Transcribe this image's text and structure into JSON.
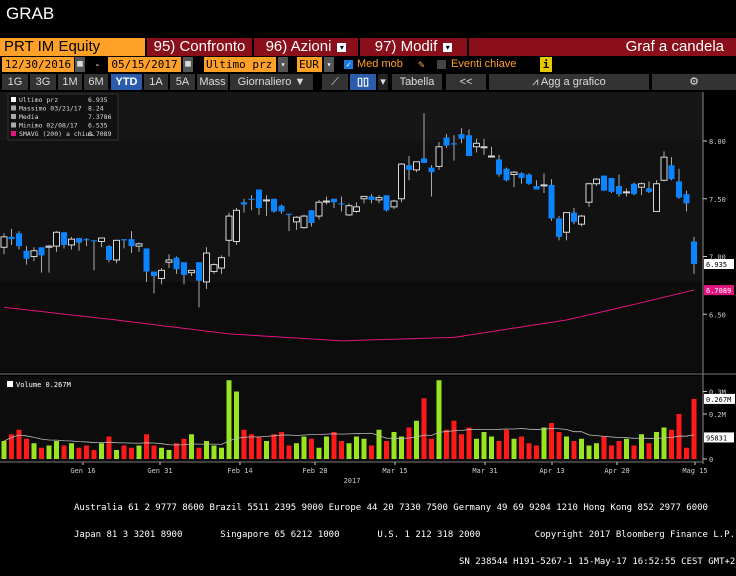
{
  "title": "GRAB",
  "toolbar1": {
    "security": "PRT IM Equity",
    "compare": "95) Confronto",
    "actions": "96) Azioni",
    "edit": "97) Modif",
    "chart_type": "Graf a candela"
  },
  "toolbar2": {
    "start_date": "12/30/2016",
    "dash": "-",
    "end_date": "05/15/2017",
    "field": "Ultimo prz",
    "currency": "EUR",
    "moving_avg_label": "Med mob",
    "moving_avg_checked": true,
    "events_label": "Eventi chiave",
    "events_checked": false,
    "info": "i"
  },
  "toolbar3": {
    "periods": [
      "1G",
      "3G",
      "1M",
      "6M",
      "YTD",
      "1A",
      "5A",
      "Mass"
    ],
    "selected_period": "YTD",
    "frequency": "Giornaliero ▼",
    "table": "Tabella",
    "collapse": "<<",
    "add_to_chart": "Agg a grafico"
  },
  "legend": [
    {
      "label": "Ultimo prz",
      "value": "6.935"
    },
    {
      "label": "Massimo 03/21/17",
      "value": "8.24"
    },
    {
      "label": "Media",
      "value": "7.3786"
    },
    {
      "label": "Minimo 02/08/17",
      "value": "6.535"
    },
    {
      "label": "SMAVG (200) a chius",
      "value": "6.7089"
    }
  ],
  "volume_legend": "Volume 0.267M",
  "colors": {
    "up_candle": "#ffffff",
    "down_candle": "#0a84ff",
    "sma": "#e0157f",
    "vol_up": "#99e620",
    "vol_down": "#ff1a1a",
    "last_price_tag": "#ffffff",
    "sma_tag": "#e0157f"
  },
  "chart_data": {
    "type": "candlestick",
    "price_axis": {
      "ticks": [
        "8.00",
        "7.50",
        "7.00",
        "6.50"
      ],
      "ylim": [
        6.2,
        8.4
      ]
    },
    "last_price_label": "6.935",
    "sma_label": "6.7089",
    "ohlc": [
      [
        7.08,
        7.2,
        7.02,
        7.17
      ],
      [
        7.17,
        7.24,
        7.1,
        7.15
      ],
      [
        7.2,
        7.22,
        7.06,
        7.09
      ],
      [
        7.05,
        7.09,
        6.93,
        6.98
      ],
      [
        7.0,
        7.08,
        6.96,
        7.05
      ],
      [
        7.08,
        7.08,
        6.86,
        7.01
      ],
      [
        7.08,
        7.1,
        6.86,
        7.09
      ],
      [
        7.09,
        7.22,
        7.04,
        7.21
      ],
      [
        7.21,
        7.21,
        7.07,
        7.1
      ],
      [
        7.1,
        7.17,
        7.06,
        7.15
      ],
      [
        7.16,
        7.16,
        7.05,
        7.12
      ],
      [
        7.15,
        7.16,
        7.09,
        7.14
      ],
      [
        7.14,
        7.14,
        6.88,
        7.13
      ],
      [
        7.13,
        7.16,
        7.08,
        7.16
      ],
      [
        7.09,
        7.1,
        6.95,
        6.97
      ],
      [
        6.97,
        7.14,
        6.94,
        7.14
      ],
      [
        7.15,
        7.15,
        7.07,
        7.14
      ],
      [
        7.15,
        7.22,
        7.03,
        7.09
      ],
      [
        7.09,
        7.12,
        7.04,
        7.11
      ],
      [
        7.07,
        7.07,
        6.78,
        6.87
      ],
      [
        6.87,
        6.87,
        6.68,
        6.83
      ],
      [
        6.81,
        6.9,
        6.76,
        6.88
      ],
      [
        6.95,
        7.02,
        6.9,
        6.97
      ],
      [
        6.99,
        7.0,
        6.85,
        6.89
      ],
      [
        6.95,
        6.95,
        6.76,
        6.84
      ],
      [
        6.86,
        6.88,
        6.83,
        6.88
      ],
      [
        6.95,
        6.95,
        6.56,
        6.79
      ],
      [
        6.78,
        7.08,
        6.72,
        7.03
      ],
      [
        6.87,
        6.94,
        6.85,
        6.93
      ],
      [
        6.9,
        7.01,
        6.85,
        6.99
      ],
      [
        7.14,
        7.38,
        7.0,
        7.35
      ],
      [
        7.13,
        7.42,
        7.1,
        7.4
      ],
      [
        7.47,
        7.5,
        7.38,
        7.45
      ],
      [
        7.5,
        7.53,
        7.4,
        7.49
      ],
      [
        7.58,
        7.58,
        7.36,
        7.42
      ],
      [
        7.49,
        7.53,
        7.35,
        7.49
      ],
      [
        7.5,
        7.5,
        7.38,
        7.39
      ],
      [
        7.44,
        7.45,
        7.37,
        7.39
      ],
      [
        7.37,
        7.37,
        7.22,
        7.36
      ],
      [
        7.3,
        7.35,
        7.23,
        7.34
      ],
      [
        7.25,
        7.36,
        7.24,
        7.35
      ],
      [
        7.4,
        7.4,
        7.26,
        7.29
      ],
      [
        7.35,
        7.49,
        7.32,
        7.47
      ],
      [
        7.48,
        7.52,
        7.45,
        7.48
      ],
      [
        7.5,
        7.5,
        7.42,
        7.47
      ],
      [
        7.46,
        7.52,
        7.39,
        7.45
      ],
      [
        7.36,
        7.46,
        7.35,
        7.44
      ],
      [
        7.39,
        7.47,
        7.38,
        7.43
      ],
      [
        7.5,
        7.52,
        7.46,
        7.52
      ],
      [
        7.52,
        7.54,
        7.46,
        7.49
      ],
      [
        7.49,
        7.53,
        7.46,
        7.51
      ],
      [
        7.53,
        7.53,
        7.39,
        7.4
      ],
      [
        7.43,
        7.49,
        7.41,
        7.48
      ],
      [
        7.5,
        7.81,
        7.47,
        7.8
      ],
      [
        7.79,
        7.87,
        7.66,
        7.75
      ],
      [
        7.75,
        7.82,
        7.73,
        7.82
      ],
      [
        7.85,
        8.24,
        7.81,
        7.81
      ],
      [
        7.77,
        7.79,
        7.52,
        7.73
      ],
      [
        7.78,
        7.99,
        7.75,
        7.95
      ],
      [
        8.03,
        8.06,
        7.94,
        7.96
      ],
      [
        7.98,
        8.05,
        7.83,
        7.97
      ],
      [
        8.06,
        8.11,
        7.98,
        8.02
      ],
      [
        8.05,
        8.1,
        7.87,
        7.87
      ],
      [
        7.95,
        8.02,
        7.9,
        7.98
      ],
      [
        7.95,
        8.02,
        7.88,
        7.95
      ],
      [
        7.87,
        7.95,
        7.86,
        7.87
      ],
      [
        7.84,
        7.88,
        7.69,
        7.71
      ],
      [
        7.76,
        7.77,
        7.65,
        7.66
      ],
      [
        7.71,
        7.74,
        7.6,
        7.73
      ],
      [
        7.72,
        7.73,
        7.63,
        7.68
      ],
      [
        7.71,
        7.72,
        7.62,
        7.63
      ],
      [
        7.61,
        7.66,
        7.59,
        7.58
      ],
      [
        7.62,
        7.72,
        7.55,
        7.62
      ],
      [
        7.62,
        7.67,
        7.31,
        7.33
      ],
      [
        7.33,
        7.35,
        7.14,
        7.17
      ],
      [
        7.21,
        7.38,
        7.14,
        7.38
      ],
      [
        7.38,
        7.42,
        7.28,
        7.3
      ],
      [
        7.28,
        7.36,
        7.26,
        7.35
      ],
      [
        7.47,
        7.64,
        7.43,
        7.63
      ],
      [
        7.63,
        7.68,
        7.61,
        7.67
      ],
      [
        7.7,
        7.7,
        7.57,
        7.57
      ],
      [
        7.68,
        7.68,
        7.55,
        7.56
      ],
      [
        7.61,
        7.71,
        7.52,
        7.54
      ],
      [
        7.56,
        7.59,
        7.52,
        7.56
      ],
      [
        7.63,
        7.64,
        7.53,
        7.54
      ],
      [
        7.6,
        7.64,
        7.53,
        7.63
      ],
      [
        7.59,
        7.65,
        7.55,
        7.56
      ],
      [
        7.39,
        7.66,
        7.39,
        7.63
      ],
      [
        7.66,
        7.91,
        7.65,
        7.86
      ],
      [
        7.79,
        7.86,
        7.66,
        7.67
      ],
      [
        7.65,
        7.76,
        7.5,
        7.51
      ],
      [
        7.54,
        7.57,
        7.39,
        7.46
      ],
      [
        7.13,
        7.17,
        6.85,
        6.935
      ]
    ],
    "sma200": [
      [
        0,
        6.56
      ],
      [
        15,
        6.45
      ],
      [
        30,
        6.33
      ],
      [
        45,
        6.27
      ],
      [
        60,
        6.3
      ],
      [
        75,
        6.45
      ],
      [
        85,
        6.6
      ],
      [
        92,
        6.71
      ]
    ],
    "volume_M": [
      0.08,
      0.11,
      0.13,
      0.09,
      0.07,
      0.05,
      0.06,
      0.08,
      0.06,
      0.07,
      0.05,
      0.06,
      0.04,
      0.07,
      0.1,
      0.04,
      0.06,
      0.05,
      0.06,
      0.11,
      0.06,
      0.05,
      0.04,
      0.07,
      0.09,
      0.11,
      0.05,
      0.08,
      0.06,
      0.05,
      0.35,
      0.3,
      0.13,
      0.11,
      0.1,
      0.08,
      0.11,
      0.12,
      0.06,
      0.07,
      0.1,
      0.09,
      0.05,
      0.1,
      0.12,
      0.08,
      0.07,
      0.1,
      0.09,
      0.06,
      0.13,
      0.08,
      0.12,
      0.1,
      0.14,
      0.17,
      0.27,
      0.09,
      0.35,
      0.13,
      0.17,
      0.11,
      0.14,
      0.09,
      0.12,
      0.1,
      0.08,
      0.13,
      0.09,
      0.1,
      0.07,
      0.06,
      0.14,
      0.16,
      0.12,
      0.1,
      0.08,
      0.09,
      0.06,
      0.07,
      0.1,
      0.06,
      0.08,
      0.09,
      0.06,
      0.11,
      0.07,
      0.12,
      0.14,
      0.13,
      0.2,
      0.05,
      0.267
    ],
    "volume_axis": {
      "ticks": [
        "0.3M",
        "0.2M",
        "0"
      ],
      "last_label": "0.267M",
      "avg_label": "95831"
    },
    "x_ticks": [
      "Gen 16",
      "Gen 31",
      "Feb 14",
      "Feb 28",
      "Mar 15",
      "Mar 31",
      "Apr 13",
      "Apr 28",
      "Mag 15"
    ],
    "x_year": "2017"
  },
  "footer": {
    "line1": "Australia 61 2 9777 8600 Brazil 5511 2395 9000 Europe 44 20 7330 7500 Germany 49 69 9204 1210 Hong Kong 852 2977 6000",
    "line2": "Japan 81 3 3201 8900       Singapore 65 6212 1000       U.S. 1 212 318 2000          Copyright 2017 Bloomberg Finance L.P.",
    "line3": "SN 238544 H191-5267-1 15-May-17 16:52:55 CEST GMT+2:00"
  }
}
